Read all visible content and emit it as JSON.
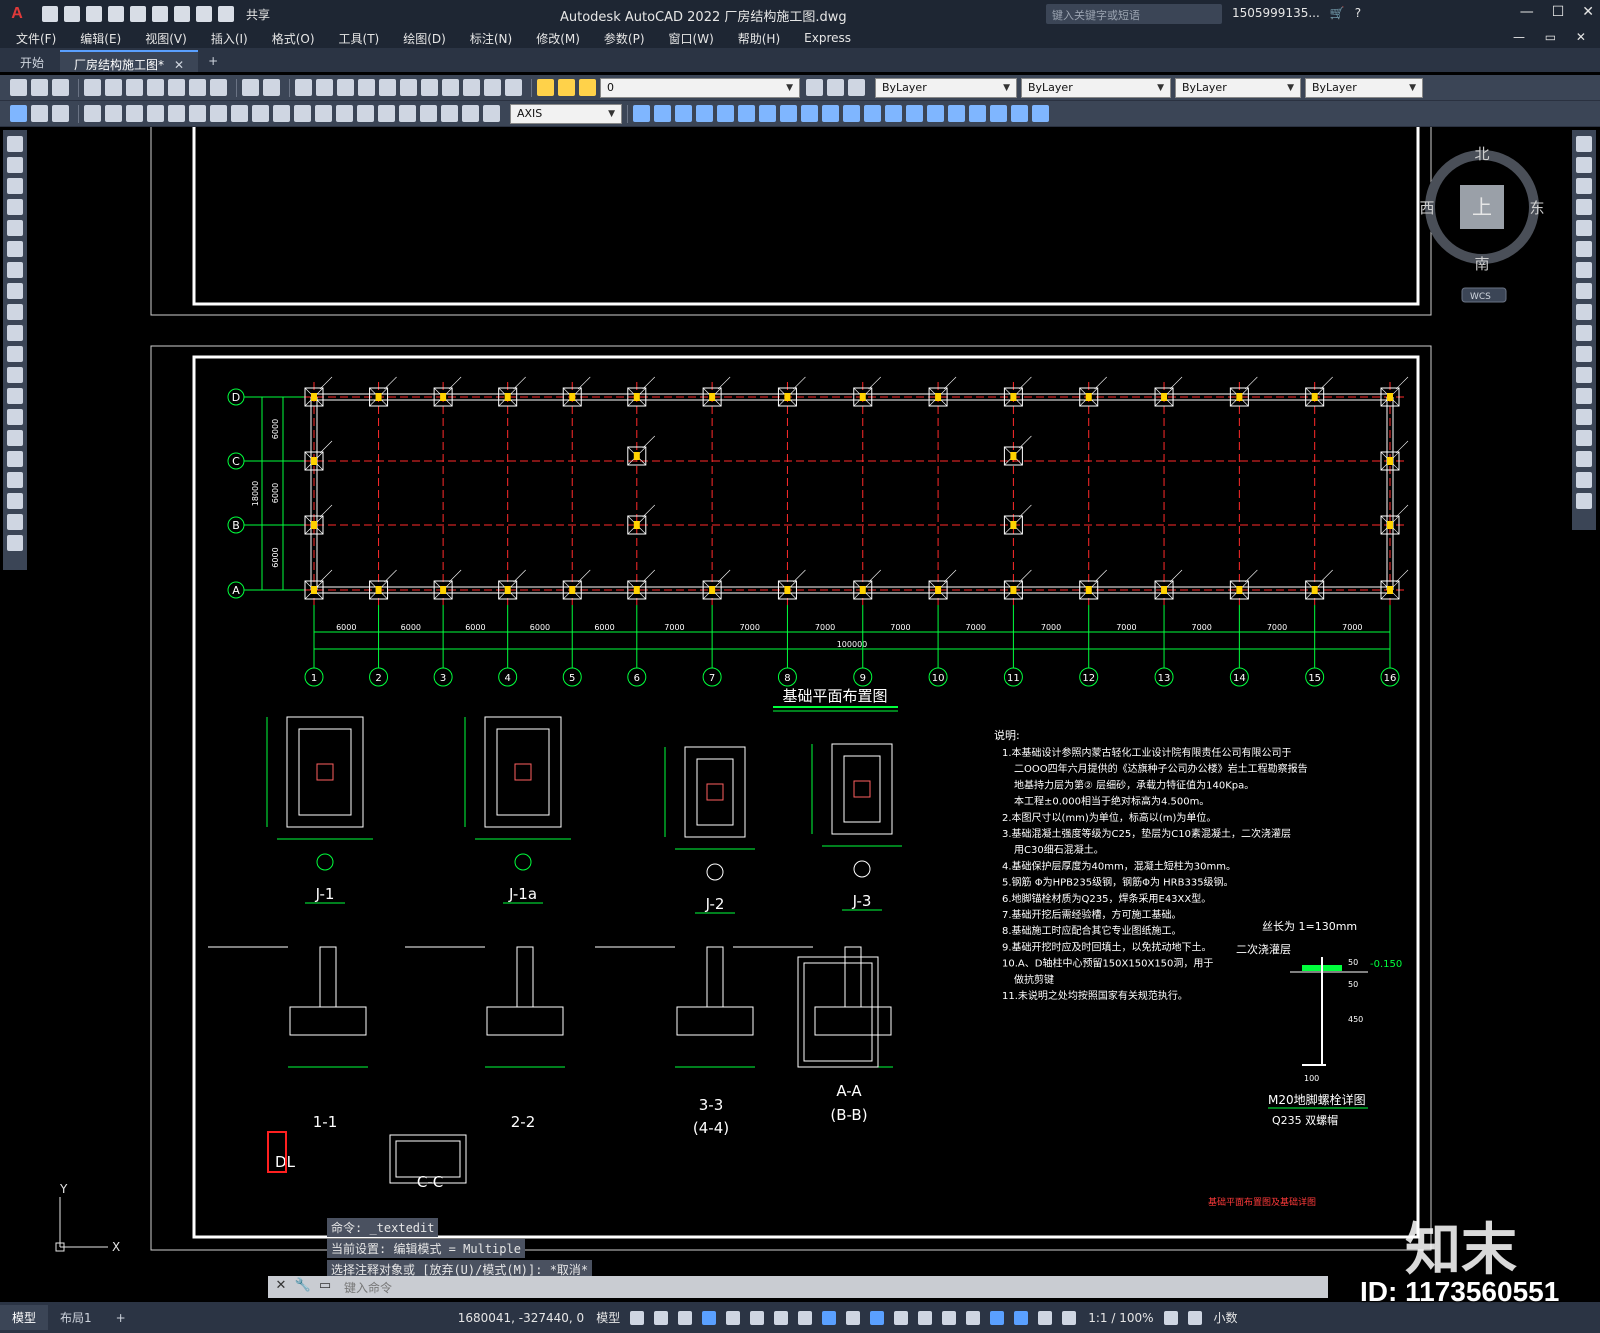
{
  "app": {
    "logo": "A",
    "title": "Autodesk AutoCAD 2022    厂房结构施工图.dwg",
    "share_label": "共享",
    "search_placeholder": "键入关键字或短语",
    "user": "1505999135...",
    "window_controls": [
      "—",
      "☐",
      "✕"
    ],
    "mdi_controls": "— ▭ ✕"
  },
  "menu": [
    "文件(F)",
    "编辑(E)",
    "视图(V)",
    "插入(I)",
    "格式(O)",
    "工具(T)",
    "绘图(D)",
    "标注(N)",
    "修改(M)",
    "参数(P)",
    "窗口(W)",
    "帮助(H)",
    "Express"
  ],
  "file_tabs": [
    {
      "label": "开始",
      "active": false
    },
    {
      "label": "厂房结构施工图*",
      "active": true
    }
  ],
  "toolbar": {
    "layer_value": "0",
    "color_value": "ByLayer",
    "linetype_value": "ByLayer",
    "lineweight_value": "ByLayer",
    "plotstyle_value": "ByLayer",
    "dimstyle_value": "AXIS"
  },
  "viewcube": {
    "north": "北",
    "south": "南",
    "east": "东",
    "west": "西",
    "top": "上",
    "wcs": "WCS"
  },
  "drawing": {
    "plan_title": "基础平面布置图",
    "row_axes": [
      "D",
      "C",
      "B",
      "A"
    ],
    "row_dims": [
      "6000",
      "6000",
      "6000"
    ],
    "row_total": "18000",
    "col_axes": [
      "1",
      "2",
      "3",
      "4",
      "5",
      "6",
      "7",
      "8",
      "9",
      "10",
      "11",
      "12",
      "13",
      "14",
      "15",
      "16"
    ],
    "col_dims": [
      "6000",
      "6000",
      "6000",
      "6000",
      "6000",
      "7000",
      "7000",
      "7000",
      "7000",
      "7000",
      "7000",
      "7000",
      "7000",
      "7000",
      "7000"
    ],
    "col_total": "100000",
    "details": [
      "J-1",
      "J-1a",
      "J-2",
      "J-3"
    ],
    "sections": [
      "1-1",
      "2-2",
      "3-3",
      "(4-4)",
      "A-A",
      "(B-B)",
      "DL",
      "C-C"
    ],
    "notes_title": "说明:",
    "notes": [
      "1.本基础设计参照内蒙古轻化工业设计院有限责任公司有限公司于",
      "二OOO四年六月提供的《达旗种子公司办公楼》岩土工程勘察报告",
      "地基持力层为第② 层细砂，承载力特征值为140Kpa。",
      "本工程±0.000相当于绝对标高为4.500m。",
      "2.本图尺寸以(mm)为单位，标高以(m)为单位。",
      "3.基础混凝土强度等级为C25，垫层为C10素混凝土，二次浇灌层",
      "用C30细石混凝土。",
      "4.基础保护层厚度为40mm，混凝土短柱为30mm。",
      "5.钢筋 Φ为HPB235级钢，钢筋Φ为 HRB335级钢。",
      "6.地脚锚栓材质为Q235，焊条采用E43XX型。",
      "7.基础开挖后需经验槽，方可施工基础。",
      "8.基础施工时应配合其它专业图纸施工。",
      "9.基础开挖时应及时回填土，以免扰动地下土。",
      "10.A、D轴柱中心预留150X150X150洞，用于",
      "做抗剪键",
      "11.未说明之处均按照国家有关规范执行。"
    ],
    "bolt_title": "M20地脚螺栓详图",
    "bolt_sub": "Q235 双螺帽",
    "bolt_label1": "丝长为 1=130mm",
    "bolt_label2": "二次浇灌层",
    "bolt_level": "-0.150",
    "sheet_caption": "基础平面布置图及基础详图"
  },
  "command": {
    "history": [
      "命令: _textedit",
      "当前设置: 编辑模式 = Multiple",
      "选择注释对象或 [放弃(U)/模式(M)]: *取消*"
    ],
    "placeholder": "键入命令"
  },
  "status": {
    "layout_tabs": [
      "模型",
      "布局1",
      "+"
    ],
    "coords": "1680041, -327440, 0",
    "model_label": "模型",
    "scale": "1:1 / 100%",
    "units": "小数"
  },
  "watermark": {
    "logo": "知末",
    "id": "ID: 1173560551"
  },
  "colors": {
    "title_bg": "#1e2633",
    "toolbar_bg": "#3b4556",
    "axis_green": "#00ff3c",
    "grid_red": "#ff2a2a",
    "wall_white": "#ffffff",
    "label_yellow": "#ffd200"
  }
}
